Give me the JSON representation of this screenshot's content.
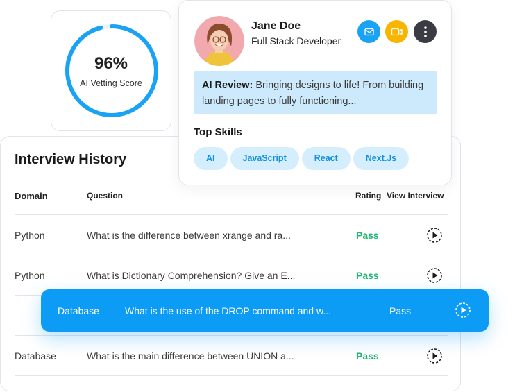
{
  "score": {
    "value": "96%",
    "percent": 96,
    "label": "AI Vetting Score",
    "ring_color": "#1aa3f5"
  },
  "profile": {
    "name": "Jane Doe",
    "role": "Full Stack Developer",
    "avatar_icon": "avatar-photo",
    "actions": [
      {
        "icon": "mail-icon",
        "color": "#1aa3f5"
      },
      {
        "icon": "video-camera-icon",
        "color": "#f7b500"
      },
      {
        "icon": "more-vertical-icon",
        "color": "#3b3b44"
      }
    ],
    "review_label": "AI Review:",
    "review_text": " Bringing designs to life! From building landing pages to fully functioning...",
    "skills_title": "Top Skills",
    "skills": [
      "AI",
      "JavaScript",
      "React",
      "Next.Js"
    ]
  },
  "history": {
    "title": "Interview History",
    "columns": {
      "domain": "Domain",
      "question": "Question",
      "rating": "Rating",
      "view": "View Interview"
    },
    "rows": [
      {
        "domain": "Python",
        "question": "What is the difference between xrange and ra...",
        "rating": "Pass"
      },
      {
        "domain": "Python",
        "question": "What is Dictionary Comprehension? Give an E...",
        "rating": "Pass"
      },
      {
        "domain": "Database",
        "question": "What is the use of the DROP command and w...",
        "rating": "Pass"
      },
      {
        "domain": "Database",
        "question": "What is the main difference between UNION a...",
        "rating": "Pass"
      }
    ],
    "pass_color": "#22b573",
    "highlight_color": "#0c9cf5"
  }
}
